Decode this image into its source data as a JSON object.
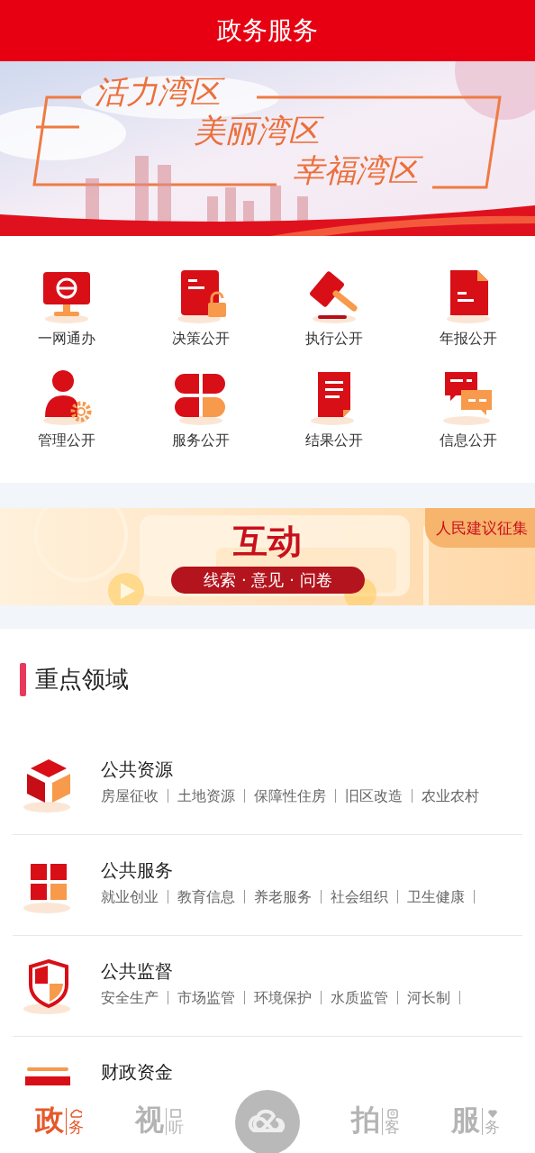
{
  "header": {
    "title": "政务服务"
  },
  "hero_banner": {
    "kind": "picture",
    "lines": [
      "活力湾区",
      "美丽湾区",
      "幸福湾区"
    ]
  },
  "shortcuts": [
    {
      "label": "一网通办"
    },
    {
      "label": "决策公开"
    },
    {
      "label": "执行公开"
    },
    {
      "label": "年报公开"
    },
    {
      "label": "管理公开"
    },
    {
      "label": "服务公开"
    },
    {
      "label": "结果公开"
    },
    {
      "label": "信息公开"
    }
  ],
  "interaction_banner": {
    "title": "互动",
    "subtitle": "线索 · 意见 · 问卷",
    "tag": "人民建议征集"
  },
  "key_areas": {
    "title": "重点领域",
    "rows": [
      {
        "title": "公共资源",
        "tags": [
          "房屋征收",
          "土地资源",
          "保障性住房",
          "旧区改造",
          "农业农村"
        ],
        "trailing_separator": false
      },
      {
        "title": "公共服务",
        "tags": [
          "就业创业",
          "教育信息",
          "养老服务",
          "社会组织",
          "卫生健康"
        ],
        "trailing_separator": true
      },
      {
        "title": "公共监督",
        "tags": [
          "安全生产",
          "市场监管",
          "环境保护",
          "水质监管",
          "河长制"
        ],
        "trailing_separator": true
      },
      {
        "title": "财政资金"
      }
    ]
  },
  "tab_bar": [
    {
      "kind": "tab",
      "main": "政",
      "sub": "务",
      "selected": true
    },
    {
      "kind": "tab",
      "main": "视",
      "sub": "听",
      "selected": false
    },
    {
      "kind": "center"
    },
    {
      "kind": "tab",
      "main": "拍",
      "sub": "客",
      "selected": false
    },
    {
      "kind": "tab",
      "main": "服",
      "sub": "务",
      "selected": false
    }
  ]
}
